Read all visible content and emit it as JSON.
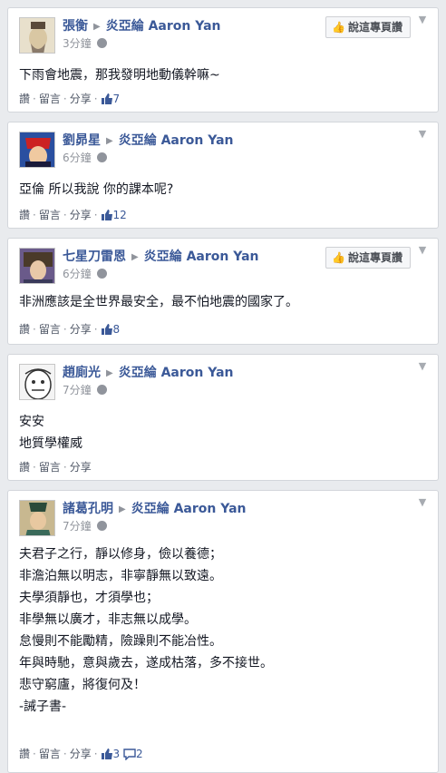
{
  "page_name": "炎亞綸 Aaron Yan",
  "actions": {
    "like": "讚",
    "comment": "留言",
    "share": "分享"
  },
  "like_page_button": "說這專頁讚",
  "posts": [
    {
      "author": "張衡",
      "time": "3分鐘",
      "lines": [
        "下雨會地震，那我發明地動儀幹嘛~"
      ],
      "likes": "7",
      "comments": "",
      "show_like_page": true
    },
    {
      "author": "劉昴星",
      "time": "6分鐘",
      "lines": [
        "亞倫 所以我說 你的課本呢?"
      ],
      "likes": "12",
      "comments": "",
      "show_like_page": false
    },
    {
      "author": "七星刀雷恩",
      "time": "6分鐘",
      "lines": [
        "非洲應該是全世界最安全，最不怕地震的國家了。"
      ],
      "likes": "8",
      "comments": "",
      "show_like_page": true
    },
    {
      "author": "趙廁光",
      "time": "7分鐘",
      "lines": [
        "安安",
        "地質學權威"
      ],
      "likes": "",
      "comments": "",
      "show_like_page": false
    },
    {
      "author": "諸葛孔明",
      "time": "7分鐘",
      "lines": [
        "夫君子之行，靜以修身，儉以養德；",
        "非澹泊無以明志，非寧靜無以致遠。",
        "夫學須靜也，才須學也；",
        "非學無以廣才，非志無以成學。",
        "怠慢則不能勵精，險躁則不能冶性。",
        "年與時馳，意與歲去，遂成枯落，多不接世。",
        "悲守窮廬，將復何及！",
        "-誡子書-"
      ],
      "likes": "3",
      "comments": "2",
      "show_like_page": false
    }
  ]
}
